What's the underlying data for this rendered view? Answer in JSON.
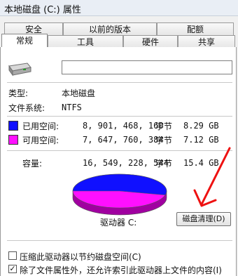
{
  "window": {
    "title": "本地磁盘 (C:) 属性"
  },
  "tabs_row1": [
    "安全",
    "以前的版本",
    "配额"
  ],
  "tabs_row2": [
    "常规",
    "工具",
    "硬件",
    "共享"
  ],
  "general": {
    "drive_name_value": "",
    "type_label": "类型:",
    "type_value": "本地磁盘",
    "fs_label": "文件系统:",
    "fs_value": "NTFS"
  },
  "usage": {
    "used_label": "已用空间:",
    "used_bytes": "8, 901, 468, 160",
    "used_unit": "字节",
    "used_gb": "8.29 GB",
    "free_label": "可用空间:",
    "free_bytes": "7, 647, 760, 384",
    "free_unit": "字节",
    "free_gb": "7.12 GB",
    "capacity_label": "容量:",
    "capacity_bytes": "16, 549, 228, 544",
    "capacity_unit": "字节",
    "capacity_gb": "15.4 GB",
    "used_color": "#1010ff",
    "free_color": "#ff10ff"
  },
  "pie": {
    "used_fraction": 0.538
  },
  "drive_label": "驱动器 C:",
  "cleanup_button": "磁盘清理(D)",
  "options": [
    {
      "label": "压缩此驱动器以节约磁盘空间(C)",
      "checked": false
    },
    {
      "label": "除了文件属性外，还允许索引此驱动器上文件的内容(I)",
      "checked": true
    }
  ],
  "icons": [
    "drive-icon",
    "red-arrow-icon"
  ]
}
